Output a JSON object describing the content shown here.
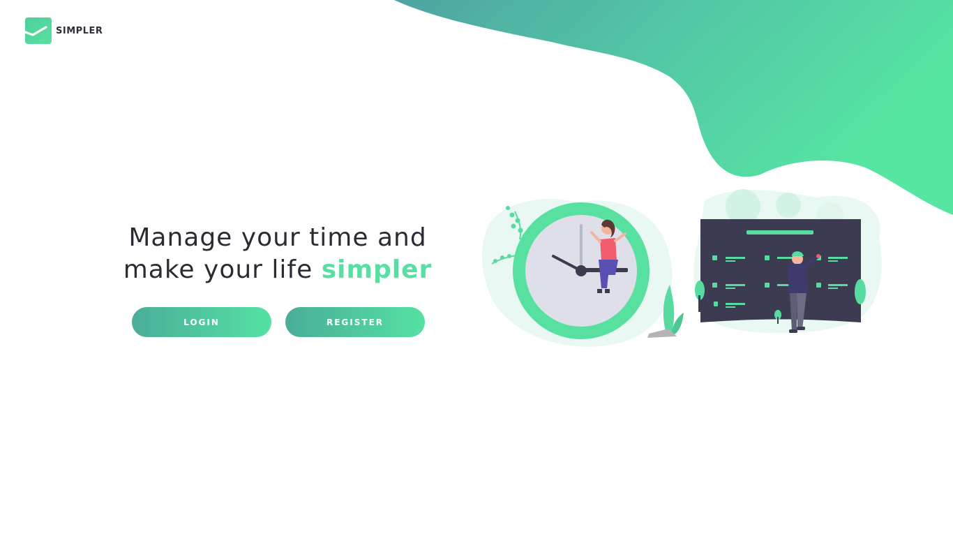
{
  "brand": {
    "name": "SIMPLER",
    "accent_color": "#57e0a2",
    "gradient_start": "#4aad98",
    "gradient_end": "#55e1a3",
    "logo_icon": "check-icon"
  },
  "hero": {
    "headline_line1": "Manage your time and",
    "headline_line2_prefix": "make your life ",
    "headline_line2_accent": "simpler"
  },
  "actions": {
    "login_label": "LOGIN",
    "register_label": "REGISTER"
  },
  "illustration": {
    "left_scene": "clock-with-person-icon",
    "right_scene": "dashboard-with-person-icon"
  }
}
